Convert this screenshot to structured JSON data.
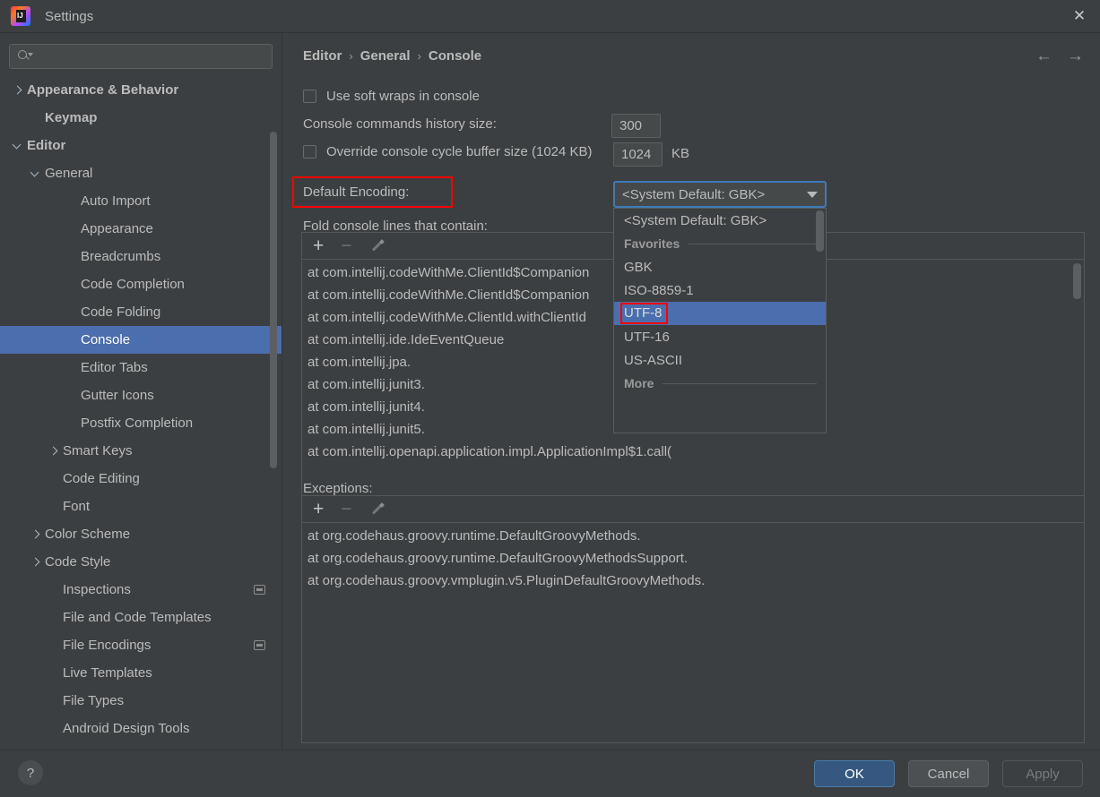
{
  "window": {
    "title": "Settings",
    "logo_text": "IJ",
    "close_icon": "✕"
  },
  "sidebar": {
    "search": {
      "placeholder": "",
      "value": ""
    },
    "items": [
      {
        "label": "Appearance & Behavior",
        "indent": 0,
        "chevron": "right",
        "bold": true,
        "selected": false,
        "badge": false
      },
      {
        "label": "Keymap",
        "indent": 1,
        "chevron": "none",
        "bold": true,
        "selected": false,
        "badge": false
      },
      {
        "label": "Editor",
        "indent": 0,
        "chevron": "down",
        "bold": true,
        "selected": false,
        "badge": false
      },
      {
        "label": "General",
        "indent": 1,
        "chevron": "down",
        "bold": false,
        "selected": false,
        "badge": false
      },
      {
        "label": "Auto Import",
        "indent": 3,
        "chevron": "none",
        "bold": false,
        "selected": false,
        "badge": false
      },
      {
        "label": "Appearance",
        "indent": 3,
        "chevron": "none",
        "bold": false,
        "selected": false,
        "badge": false
      },
      {
        "label": "Breadcrumbs",
        "indent": 3,
        "chevron": "none",
        "bold": false,
        "selected": false,
        "badge": false
      },
      {
        "label": "Code Completion",
        "indent": 3,
        "chevron": "none",
        "bold": false,
        "selected": false,
        "badge": false
      },
      {
        "label": "Code Folding",
        "indent": 3,
        "chevron": "none",
        "bold": false,
        "selected": false,
        "badge": false
      },
      {
        "label": "Console",
        "indent": 3,
        "chevron": "none",
        "bold": false,
        "selected": true,
        "badge": false
      },
      {
        "label": "Editor Tabs",
        "indent": 3,
        "chevron": "none",
        "bold": false,
        "selected": false,
        "badge": false
      },
      {
        "label": "Gutter Icons",
        "indent": 3,
        "chevron": "none",
        "bold": false,
        "selected": false,
        "badge": false
      },
      {
        "label": "Postfix Completion",
        "indent": 3,
        "chevron": "none",
        "bold": false,
        "selected": false,
        "badge": false
      },
      {
        "label": "Smart Keys",
        "indent": 2,
        "chevron": "right",
        "bold": false,
        "selected": false,
        "badge": false
      },
      {
        "label": "Code Editing",
        "indent": 2,
        "chevron": "none",
        "bold": false,
        "selected": false,
        "badge": false
      },
      {
        "label": "Font",
        "indent": 2,
        "chevron": "none",
        "bold": false,
        "selected": false,
        "badge": false
      },
      {
        "label": "Color Scheme",
        "indent": 1,
        "chevron": "right",
        "bold": false,
        "selected": false,
        "badge": false
      },
      {
        "label": "Code Style",
        "indent": 1,
        "chevron": "right",
        "bold": false,
        "selected": false,
        "badge": false
      },
      {
        "label": "Inspections",
        "indent": 2,
        "chevron": "none",
        "bold": false,
        "selected": false,
        "badge": true
      },
      {
        "label": "File and Code Templates",
        "indent": 2,
        "chevron": "none",
        "bold": false,
        "selected": false,
        "badge": false
      },
      {
        "label": "File Encodings",
        "indent": 2,
        "chevron": "none",
        "bold": false,
        "selected": false,
        "badge": true
      },
      {
        "label": "Live Templates",
        "indent": 2,
        "chevron": "none",
        "bold": false,
        "selected": false,
        "badge": false
      },
      {
        "label": "File Types",
        "indent": 2,
        "chevron": "none",
        "bold": false,
        "selected": false,
        "badge": false
      },
      {
        "label": "Android Design Tools",
        "indent": 2,
        "chevron": "none",
        "bold": false,
        "selected": false,
        "badge": false
      }
    ]
  },
  "main": {
    "breadcrumb": {
      "part1": "Editor",
      "part2": "General",
      "part3": "Console",
      "separator": "›"
    },
    "nav": {
      "back_icon": "←",
      "forward_icon": "→"
    },
    "soft_wraps_label": "Use soft wraps in console",
    "history_label": "Console commands history size:",
    "history_value": "300",
    "override_label": "Override console cycle buffer size (1024 KB)",
    "override_value": "1024",
    "override_unit": "KB",
    "encoding_label": "Default Encoding:",
    "encoding_value": "<System Default: GBK>",
    "fold_label": "Fold console lines that contain:",
    "exceptions_label": "Exceptions:",
    "toolbar": {
      "add_icon": "+",
      "remove_icon": "−",
      "edit_icon": "pencil-icon"
    },
    "fold_lines": [
      "at com.intellij.codeWithMe.ClientId$Companion",
      "at com.intellij.codeWithMe.ClientId$Companion",
      "at com.intellij.codeWithMe.ClientId.withClientId",
      "at com.intellij.ide.IdeEventQueue",
      "at com.intellij.jpa.",
      "at com.intellij.junit3.",
      "at com.intellij.junit4.",
      "at com.intellij.junit5.",
      "at com.intellij.openapi.application.impl.ApplicationImpl$1.call("
    ],
    "exception_lines": [
      "at org.codehaus.groovy.runtime.DefaultGroovyMethods.",
      "at org.codehaus.groovy.runtime.DefaultGroovyMethodsSupport.",
      "at org.codehaus.groovy.vmplugin.v5.PluginDefaultGroovyMethods."
    ]
  },
  "dropdown": {
    "items": [
      {
        "label": "<System Default: GBK>",
        "type": "option",
        "selected": false
      },
      {
        "label": "Favorites",
        "type": "header",
        "selected": false
      },
      {
        "label": "GBK",
        "type": "option",
        "selected": false
      },
      {
        "label": "ISO-8859-1",
        "type": "option",
        "selected": false
      },
      {
        "label": "UTF-8",
        "type": "option",
        "selected": true
      },
      {
        "label": "UTF-16",
        "type": "option",
        "selected": false
      },
      {
        "label": "US-ASCII",
        "type": "option",
        "selected": false
      },
      {
        "label": "More",
        "type": "header",
        "selected": false
      }
    ]
  },
  "footer": {
    "help_icon": "?",
    "ok_label": "OK",
    "cancel_label": "Cancel",
    "apply_label": "Apply"
  },
  "colors": {
    "background": "#3c3f41",
    "selection": "#4b6eaf",
    "accent_ok": "#365880",
    "focus_border": "#3d7bb8",
    "highlight_red": "#ff0000",
    "text": "#bbbbbb"
  }
}
